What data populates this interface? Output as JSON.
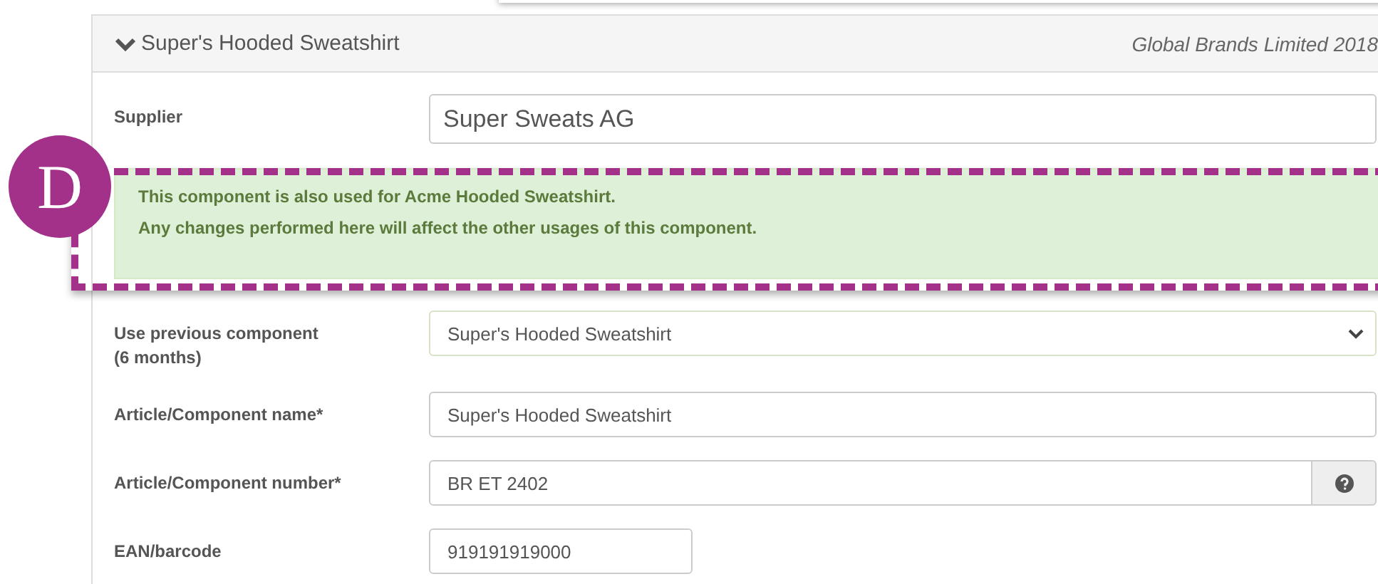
{
  "panel": {
    "title": "Super's Hooded Sweatshirt",
    "expanded": true,
    "owner": "Global Brands Limited 2018"
  },
  "supplier": {
    "label": "Supplier",
    "value": "Super Sweats AG"
  },
  "alert": {
    "lines": [
      "This component is also used for Acme Hooded Sweatshirt.",
      "Any changes performed here will affect the other usages of this component."
    ]
  },
  "annotation": {
    "label": "D"
  },
  "fields": [
    {
      "kind": "select",
      "label": "Use previous component",
      "sublabel": "(6 months)",
      "value": "Super's Hooded Sweatshirt"
    },
    {
      "kind": "text",
      "label": "Article/Component name*",
      "value": "Super's Hooded Sweatshirt"
    },
    {
      "kind": "help",
      "label": "Article/Component number*",
      "value": "BR ET 2402"
    },
    {
      "kind": "short",
      "label": "EAN/barcode",
      "value": "919191919000"
    }
  ]
}
